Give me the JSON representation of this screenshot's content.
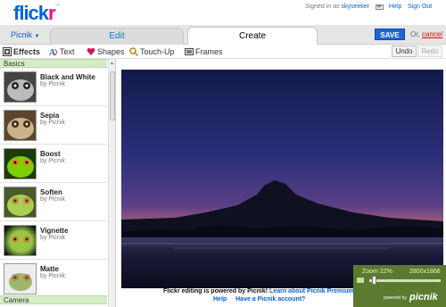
{
  "header": {
    "logo_main": "flick",
    "logo_accent": "r",
    "logo_tm": "™",
    "signed_in_prefix": "Signed in as",
    "username": "skyseeker",
    "help_label": "Help",
    "signout_label": "Sign Out"
  },
  "tabs": {
    "app_menu": "Picnik",
    "edit": "Edit",
    "create": "Create",
    "save": "SAVE",
    "or_label": "Or,",
    "cancel": "cancel"
  },
  "tools": [
    {
      "label": "Effects",
      "icon": "effects-icon"
    },
    {
      "label": "Text",
      "icon": "text-icon"
    },
    {
      "label": "Shapes",
      "icon": "shapes-icon"
    },
    {
      "label": "Touch-Up",
      "icon": "touchup-icon"
    },
    {
      "label": "Frames",
      "icon": "frames-icon"
    }
  ],
  "history": {
    "undo": "Undo",
    "redo": "Redo"
  },
  "sidebar": {
    "section_basics": "Basics",
    "section_camera": "Camera",
    "effects": [
      {
        "name": "Black and White",
        "by": "by Picnik"
      },
      {
        "name": "Sepia",
        "by": "by Picnik"
      },
      {
        "name": "Boost",
        "by": "by Picnik"
      },
      {
        "name": "Soften",
        "by": "by Picnik"
      },
      {
        "name": "Vignette",
        "by": "by Picnik"
      },
      {
        "name": "Matte",
        "by": "by Picnik"
      }
    ]
  },
  "footer": {
    "powered_text": "Flickr editing is powered by Picnik!",
    "learn_link": "Learn about Picnik Premium",
    "help_link": "Help",
    "account_link": "Have a Picnik account?"
  },
  "zoom": {
    "label": "Zoom 22%",
    "dimensions": "2800x1866",
    "powered_by": "powered by",
    "brand": "picnik"
  },
  "colors": {
    "flickr_blue": "#0063dc",
    "flickr_pink": "#ff0084",
    "save_blue": "#1f64d4",
    "basics_green": "#d6ecc8"
  }
}
